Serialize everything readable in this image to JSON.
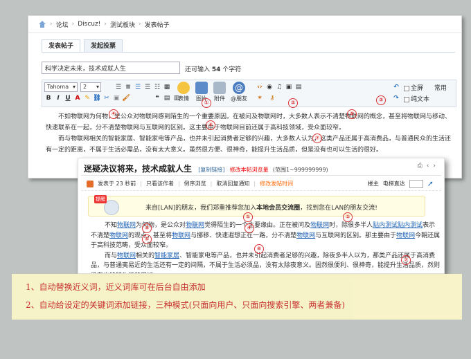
{
  "breadcrumb": [
    "论坛",
    "Discuz!",
    "测试板块",
    "发表帖子"
  ],
  "tabs": [
    "发表帖子",
    "发起投票"
  ],
  "subject_value": "科学决定未来，技术成就人生",
  "counter": {
    "prefix": "还可输入",
    "num": "54",
    "suffix": "个字符"
  },
  "toolbar": {
    "font": "Tahoma",
    "size": "2",
    "fullscreen": "全屏",
    "common": "常用",
    "plaintext": "纯文本",
    "buttons": [
      "表情",
      "图片",
      "附件",
      "@朋友"
    ]
  },
  "editor_text": {
    "p1": "不如物联网为何物，是公众对物联网感到陌生的一个重要原因。在被问及物联网时，大多数人表示不清楚物联网的概念，甚至将物联网与移动、快速联系在一起，分不清楚物联网与互联网的区别。这主要由于物联网目前还属于高科技领域，受众面较窄。",
    "p2": "而与物联网相关的智能家居、智能家电等产品，也并未引起消费者足够的兴趣，大多数人认为，这类产品还属于高消费品，与普通民众的生活还有一定的距离，不属于生活必需品，没有太大意义。虽然很方便、很神奇，能提升生活品质，但是没有也可以生活的很好。"
  },
  "post": {
    "title": "迷疑决议将来，技术成就人生",
    "copy": "[复制链接]",
    "red": "修改本帖浏览量",
    "range": "(范围1~999999999)",
    "meta": [
      "发表于 23 秒前",
      "只看该作者",
      "倒序浏览",
      "取消回复通知",
      "修改发帖时间"
    ],
    "right": [
      "楼主",
      "电梯直达"
    ],
    "tools": [
      "⎙",
      "‹",
      "›"
    ],
    "notice_tag": "提醒",
    "notice": {
      "a": "来自[LAN]的朋友，我们郑重推荐您加入",
      "b": "本地会员交流圈",
      "c": "，找到您在LAN的朋友交流!"
    },
    "p1": {
      "s1": "不知",
      "l1": "物联网",
      "s2": "为何物，是公众对",
      "l2": "物联网",
      "s3": "觉得陌生的一个主要缘由。正在被问及",
      "l3": "物联网",
      "s4": "时，除很多半人",
      "l4": "贴内测试贴内测试",
      "s5": "表示不清楚",
      "l5": "物联网",
      "s6": "的观点，甚至将",
      "l6": "物联网",
      "s7": "与挪移、快速遐想正在一路，分不清楚",
      "l7": "物联网",
      "s8": "与互联网的区别。那主要由于",
      "l8": "物联网",
      "s9": "今朝还属于高科技范畴，受众面较窄。"
    },
    "p2": {
      "s1": "而与",
      "l1": "物联网",
      "s2": "相关的",
      "l2": "智能家居",
      "s3": "、智能家电等产品，也并未引起消费者足够的兴趣，除夜多半人以为，那类产品还属于高消费品，与普通夷易近的生活还有一定的间隔，不属于生活必须品，没有太除夜意义。固然很便利、很神奇，能提升生活品质，然则没有也能够生活的很好。"
    }
  },
  "circles": [
    "①",
    "②",
    "③",
    "④",
    "⑤",
    "⑥",
    "⑦"
  ],
  "banner": [
    "1、自动替换近义词，近义词库可在后台自由添加",
    "2、自动给设定的关键词添加链接，三种模式(只面向用户、只面向搜索引擎、两者兼备)"
  ],
  "colors": {
    "red": "#d33",
    "link": "#1a5fb4",
    "banner_bg": "#fbf6c9"
  }
}
